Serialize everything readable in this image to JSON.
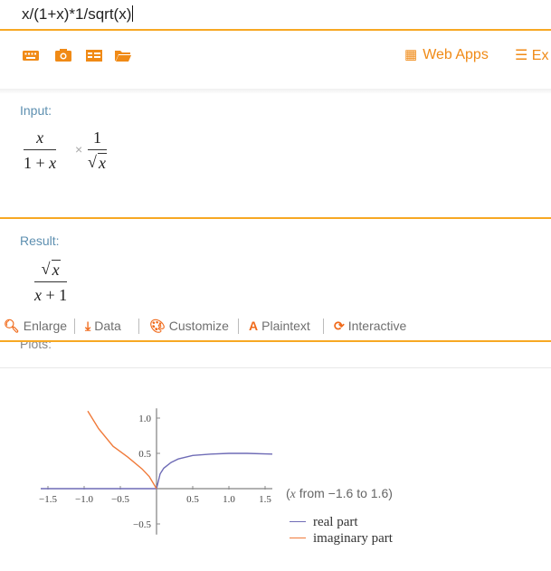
{
  "input": {
    "query": "x/(1+x)*1/sqrt(x)"
  },
  "toolbar": {
    "web_apps_label": "Web Apps",
    "ex_label": "Ex",
    "icons": [
      "keyboard-icon",
      "camera-icon",
      "table-icon",
      "folder-open-icon",
      "grid-icon",
      "menu-icon"
    ]
  },
  "input_pod": {
    "label": "Input:",
    "frac1_num": "x",
    "frac1_den_a": "1 + ",
    "frac1_den_b": "x",
    "times": "×",
    "frac2_num": "1",
    "frac2_den": "x"
  },
  "result_pod": {
    "label": "Result:",
    "num": "x",
    "den_a": "x",
    "den_b": " + 1"
  },
  "pod_tools": {
    "enlarge": "Enlarge",
    "data": "Data",
    "customize": "Customize",
    "plaintext": "Plaintext",
    "interactive": "Interactive"
  },
  "plots": {
    "label": "Plots:",
    "range_note_prefix": "(",
    "range_note_var": "x",
    "range_note_suffix": " from −1.6 to 1.6)",
    "colors": {
      "real": "#6f6cb6",
      "imaginary": "#f07a3a"
    }
  },
  "chart_data": {
    "type": "line",
    "title": "",
    "xlabel": "",
    "ylabel": "",
    "xlim": [
      -1.6,
      1.6
    ],
    "ylim": [
      -0.6,
      1.1
    ],
    "x_ticks": [
      "−1.5",
      "−1.0",
      "−0.5",
      "0.5",
      "1.0",
      "1.5"
    ],
    "y_ticks": [
      "1.0",
      "0.5",
      "−0.5"
    ],
    "series": [
      {
        "name": "real part",
        "x": [
          -1.6,
          -1.0,
          -0.5,
          0,
          0.05,
          0.1,
          0.2,
          0.3,
          0.5,
          0.75,
          1.0,
          1.25,
          1.6
        ],
        "y": [
          0,
          0,
          0,
          0,
          0.21,
          0.29,
          0.37,
          0.42,
          0.47,
          0.49,
          0.5,
          0.5,
          0.49
        ]
      },
      {
        "name": "imaginary part",
        "x": [
          -0.95,
          -0.8,
          -0.6,
          -0.4,
          -0.2,
          -0.1,
          0
        ],
        "y": [
          1.1,
          0.85,
          0.6,
          0.45,
          0.28,
          0.17,
          0
        ]
      }
    ]
  }
}
